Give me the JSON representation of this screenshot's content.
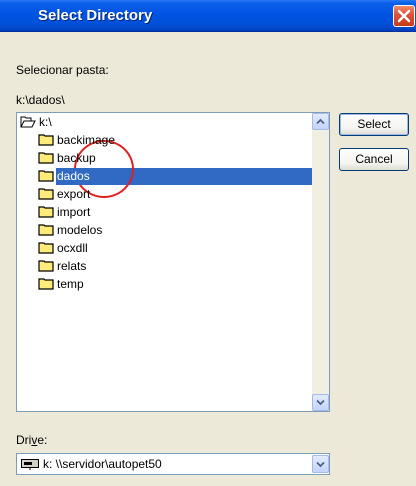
{
  "window": {
    "title": "Select Directory"
  },
  "labels": {
    "select_folder": "Selecionar pasta:",
    "current_path": "k:\\dados\\",
    "drive_prefix": "Dri",
    "drive_underlined": "v",
    "drive_suffix": "e:"
  },
  "tree": {
    "root": "k:\\",
    "folders": [
      "backimage",
      "backup",
      "dados",
      "export",
      "import",
      "modelos",
      "ocxdll",
      "relats",
      "temp"
    ],
    "selected": "dados"
  },
  "buttons": {
    "select": "Select",
    "cancel": "Cancel"
  },
  "drive": {
    "value": "k: \\\\servidor\\autopet50"
  },
  "colors": {
    "selection": "#316ac5",
    "annotation_circle": "#e01f1f",
    "titlebar": "#0054e3"
  },
  "icons": {
    "close": "close-icon",
    "folder": "folder-icon",
    "open_folder": "open-folder-icon",
    "drive": "network-drive-icon",
    "scroll_up": "chevron-up-icon",
    "scroll_down": "chevron-down-icon"
  }
}
